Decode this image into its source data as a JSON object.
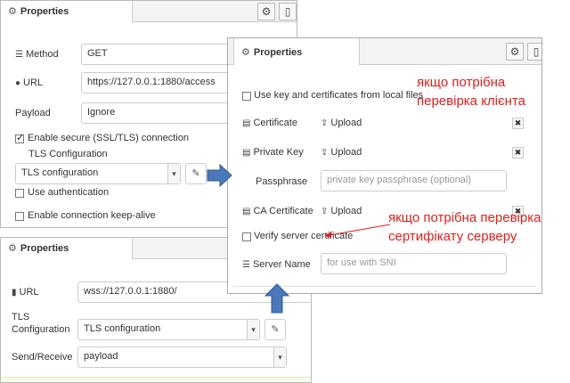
{
  "http_panel": {
    "tab_title": "Properties",
    "method_label": "Method",
    "method_value": "GET",
    "url_label": "URL",
    "url_value": "https://127.0.0.1:1880/access",
    "payload_label": "Payload",
    "payload_value": "Ignore",
    "enable_tls_label": "Enable secure (SSL/TLS) connection",
    "tls_config_label": "TLS Configuration",
    "tls_config_value": "TLS configuration",
    "use_auth_label": "Use authentication",
    "keepalive_label": "Enable connection keep-alive"
  },
  "ws_panel": {
    "tab_title": "Properties",
    "url_label": "URL",
    "url_value": "wss://127.0.0.1:1880/",
    "tls_label_line1": "TLS",
    "tls_label_line2": "Configuration",
    "tls_value": "TLS configuration",
    "send_receive_label": "Send/Receive",
    "send_receive_value": "payload"
  },
  "tls_panel": {
    "tab_title": "Properties",
    "use_key_label": "Use key and certificates from local files",
    "certificate_label": "Certificate",
    "private_key_label": "Private Key",
    "passphrase_label": "Passphrase",
    "passphrase_placeholder": "private key passphrase (optional)",
    "ca_certificate_label": "CA Certificate",
    "upload_label": "Upload",
    "verify_label": "Verify server certificate",
    "server_name_label": "Server Name",
    "server_name_placeholder": "for use with SNI"
  },
  "annotations": {
    "client_note_line1": "якщо потрібна",
    "client_note_line2": "перевірка клієнта",
    "server_note_line1": "якщо потрібна перевірка",
    "server_note_line2": "сертифікату серверу"
  },
  "colors": {
    "arrow": "#4a78b8",
    "note": "#e0201b"
  },
  "icons": [
    "gear-icon",
    "info-icon",
    "list-icon",
    "globe-icon",
    "pencil-icon",
    "upload-icon",
    "certificate-icon",
    "bookmark-icon",
    "close-icon",
    "chevron-down-icon",
    "arrow-right-icon",
    "arrow-up-icon"
  ]
}
